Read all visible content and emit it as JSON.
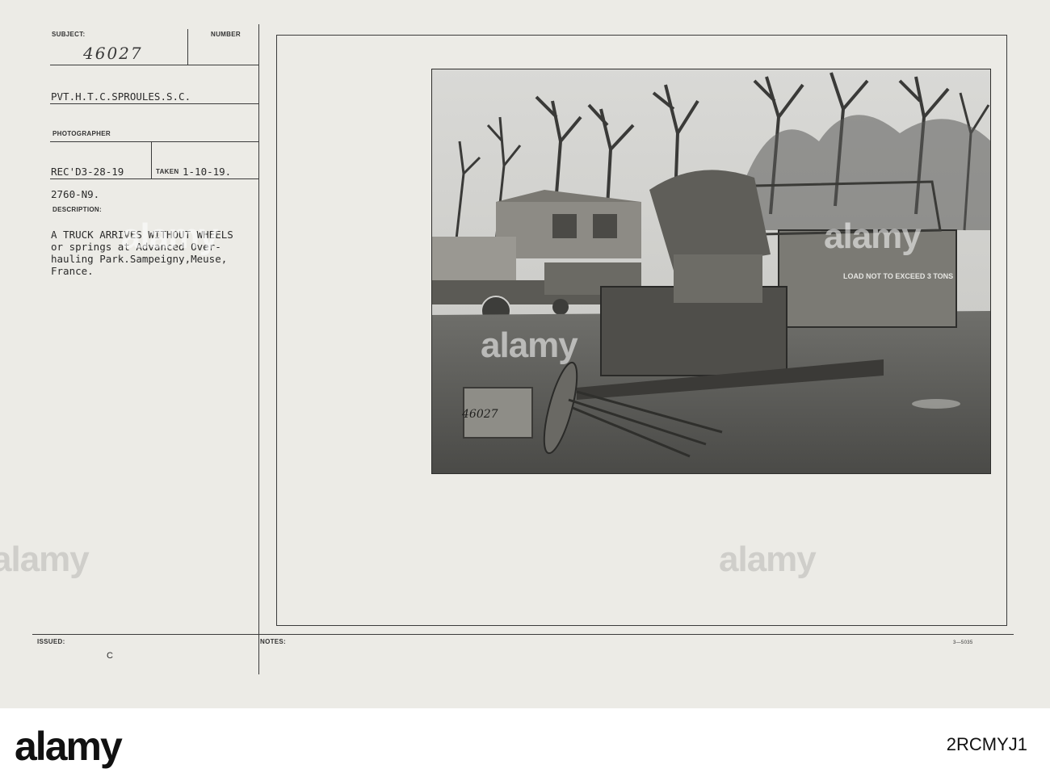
{
  "card": {
    "subject_label": "SUBJECT:",
    "number_label": "NUMBER",
    "subject_number": "46027",
    "photographer_name": "PVT.H.T.C.SPROULES.S.C.",
    "photographer_label": "PHOTOGRAPHER",
    "received": "REC'D3-28-19",
    "taken_label": "TAKEN",
    "taken_date": "1-10-19.",
    "file_code": "2760-N9.",
    "description_label": "DESCRIPTION:",
    "description_lines": [
      "A TRUCK ARRIVES WITHOUT WHEELS",
      "or springs at Advanced Over-",
      "hauling Park.Sampeigny,Meuse,",
      "France."
    ],
    "issued_label": "ISSUED:",
    "issued_value": "C",
    "notes_label": "NOTES:",
    "form_number": "3—5035"
  },
  "photo": {
    "negative_number": "46027",
    "truck_sign": "LOAD NOT TO EXCEED 3 TONS"
  },
  "stock": {
    "brand": "alamy",
    "image_id": "2RCMYJ1"
  }
}
